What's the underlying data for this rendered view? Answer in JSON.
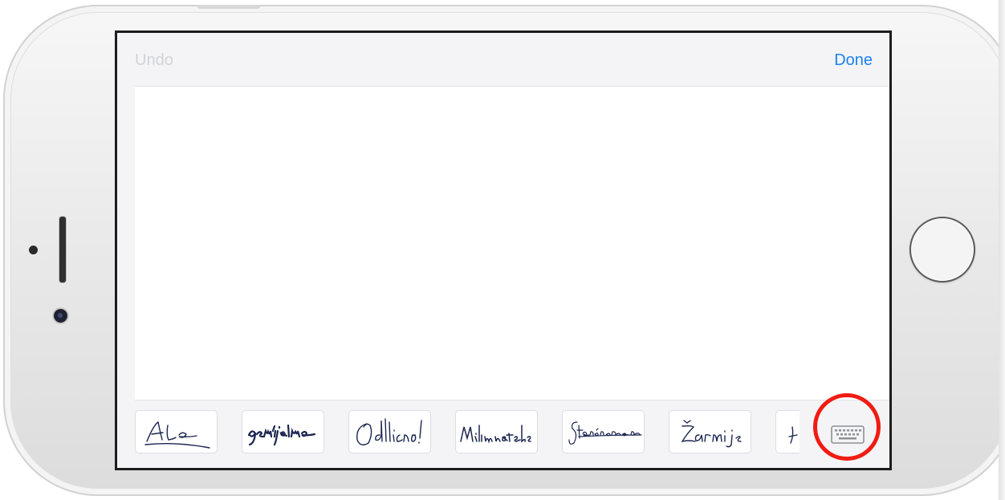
{
  "signature_pad": {
    "undo_label": "Undo",
    "done_label": "Done",
    "undo_color": "#d1d3d8",
    "done_color": "#1a82f0"
  },
  "saved_signatures": [
    {
      "name": "sig-card-1"
    },
    {
      "name": "sig-card-2"
    },
    {
      "name": "sig-card-3"
    },
    {
      "name": "sig-card-4"
    },
    {
      "name": "sig-card-5"
    },
    {
      "name": "sig-card-6"
    },
    {
      "name": "sig-card-7-partial"
    }
  ],
  "keyboard_button": {
    "icon": "keyboard-icon"
  },
  "highlight": {
    "color": "#f01c12",
    "shape": "circle",
    "target": "keyboard-icon"
  }
}
